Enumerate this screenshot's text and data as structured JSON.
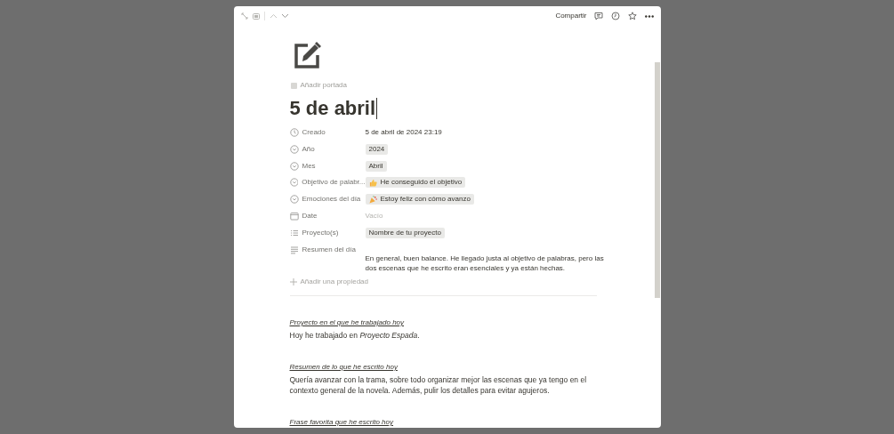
{
  "toolbar": {
    "share": "Compartir"
  },
  "page": {
    "add_cover": "Añadir portada",
    "title": "5 de abril"
  },
  "properties": [
    {
      "kind": "clock",
      "label": "Creado",
      "value": {
        "kind": "text",
        "text": "5 de abril de 2024 23:19"
      }
    },
    {
      "kind": "select",
      "label": "Año",
      "value": {
        "kind": "tag",
        "text": "2024"
      }
    },
    {
      "kind": "select",
      "label": "Mes",
      "value": {
        "kind": "tag",
        "text": "Abril"
      }
    },
    {
      "kind": "select",
      "label": "Objetivo de palabr...",
      "value": {
        "kind": "thumb_tag",
        "text": "He conseguido el objetivo"
      }
    },
    {
      "kind": "select",
      "label": "Emociones del día",
      "value": {
        "kind": "party_tag",
        "text": "Estoy feliz con cómo avanzo"
      }
    },
    {
      "kind": "calendar",
      "label": "Date",
      "value": {
        "kind": "empty",
        "text": "Vacío"
      }
    },
    {
      "kind": "list",
      "label": "Proyecto(s)",
      "value": {
        "kind": "tag",
        "text": "Nombre de tu proyecto"
      }
    },
    {
      "kind": "text",
      "label": "Resumen del día",
      "value": {
        "kind": "paragraph",
        "text": "En general, buen balance. He llegado justa al objetivo de palabras, pero las dos escenas que he escrito eran esenciales y ya están hechas."
      }
    }
  ],
  "add_property": "Añadir una propiedad",
  "sections": [
    {
      "heading": "Proyecto en el que he trabajado hoy",
      "body": "Hoy he trabajado en *Proyecto Espada*."
    },
    {
      "heading": "Resumen de lo que he escrito hoy",
      "body": "Quería avanzar con la trama, sobre todo organizar mejor las escenas que ya tengo en el contexto general de la novela. Además, pulir los detalles para evitar agujeros."
    },
    {
      "heading": "Frase favorita que he escrito hoy"
    }
  ]
}
